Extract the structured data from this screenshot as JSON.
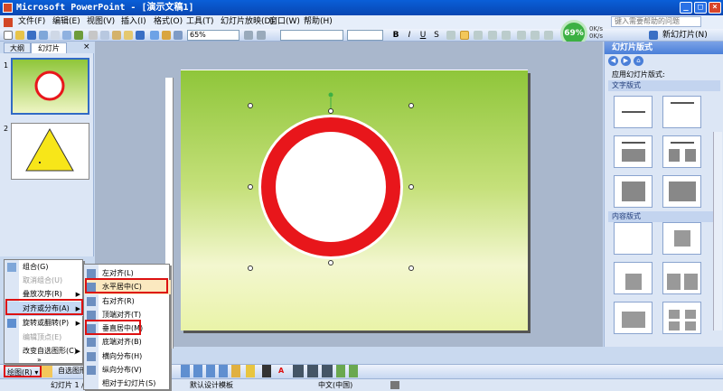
{
  "window": {
    "title": "Microsoft PowerPoint - [演示文稿1]",
    "controls": [
      "_",
      "□",
      "×"
    ]
  },
  "menubar": {
    "items": [
      "文件(F)",
      "编辑(E)",
      "视图(V)",
      "插入(I)",
      "格式(O)",
      "工具(T)",
      "幻灯片放映(D)",
      "窗口(W)",
      "帮助(H)"
    ],
    "help_placeholder": "键入需要帮助的问题"
  },
  "toolbar": {
    "zoom": "65%",
    "bold": "B",
    "italic": "I",
    "underline": "U",
    "shadow": "S",
    "new_slide": "新幻灯片(N)",
    "network_badge": "69%",
    "net_up": "0K/s",
    "net_down": "0K/s"
  },
  "left_panel": {
    "tabs": [
      "大纲",
      "幻灯片"
    ],
    "slide_numbers": [
      "1",
      "2"
    ]
  },
  "task_pane": {
    "title": "幻灯片版式",
    "apply_label": "应用幻灯片版式:",
    "section_text": "文字版式",
    "section_content": "内容版式"
  },
  "draw_menu": {
    "items": [
      {
        "label": "组合(G)",
        "disabled": false,
        "submenu": false
      },
      {
        "label": "取消组合(U)",
        "disabled": true,
        "submenu": false
      },
      {
        "label": "叠放次序(R)",
        "disabled": false,
        "submenu": true
      },
      {
        "label": "对齐或分布(A)",
        "disabled": false,
        "submenu": true
      },
      {
        "label": "旋转或翻转(P)",
        "disabled": false,
        "submenu": true
      },
      {
        "label": "编辑顶点(E)",
        "disabled": true,
        "submenu": false
      },
      {
        "label": "改变自选图形(C)",
        "disabled": false,
        "submenu": true
      }
    ],
    "more": "»"
  },
  "align_menu": {
    "items": [
      "左对齐(L)",
      "水平居中(C)",
      "右对齐(R)",
      "顶端对齐(T)",
      "垂直居中(M)",
      "底端对齐(B)",
      "横向分布(H)",
      "纵向分布(V)",
      "相对于幻灯片(S)"
    ]
  },
  "drawbar": {
    "draw_button": "绘图(R)",
    "autoshapes": "自选图形"
  },
  "statusbar": {
    "slide_info": "幻灯片 1 / 2",
    "design": "默认设计模板",
    "language": "中文(中国)"
  },
  "colors": {
    "ring": "#e8161b",
    "highlight": "#d11111",
    "title_bar": "#0a5fd8"
  }
}
